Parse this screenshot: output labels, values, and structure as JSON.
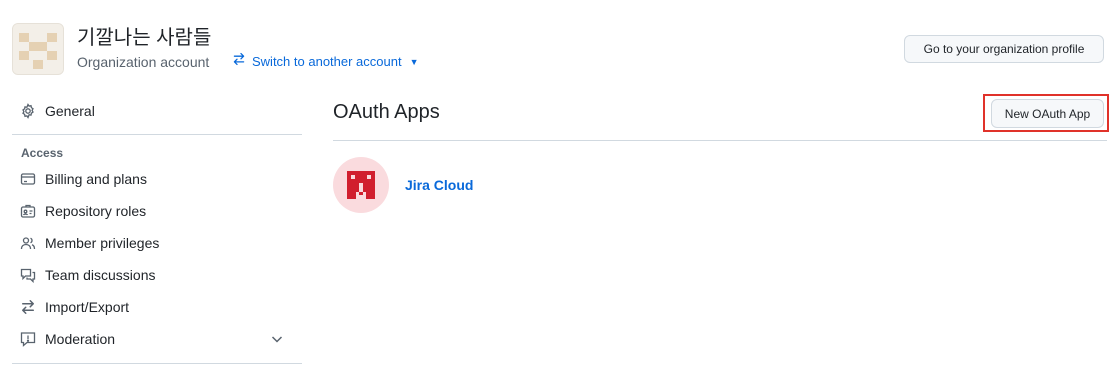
{
  "header": {
    "org_name": "기깔나는 사람들",
    "org_type": "Organization account",
    "switch_label": "Switch to another account",
    "profile_button": "Go to your organization profile"
  },
  "sidebar": {
    "general": "General",
    "section_heading": "Access",
    "items": [
      {
        "label": "Billing and plans",
        "icon": "credit-card-icon"
      },
      {
        "label": "Repository roles",
        "icon": "id-badge-icon"
      },
      {
        "label": "Member privileges",
        "icon": "people-icon"
      },
      {
        "label": "Team discussions",
        "icon": "comment-discussion-icon"
      },
      {
        "label": "Import/Export",
        "icon": "arrow-switch-icon"
      },
      {
        "label": "Moderation",
        "icon": "report-icon"
      }
    ]
  },
  "main": {
    "title": "OAuth Apps",
    "new_button": "New OAuth App",
    "apps": [
      {
        "name": "Jira Cloud"
      }
    ]
  },
  "colors": {
    "link": "#0969da",
    "highlight": "#e0322a",
    "jira_logo": "#d11f2e",
    "jira_bg": "#fadbde"
  }
}
